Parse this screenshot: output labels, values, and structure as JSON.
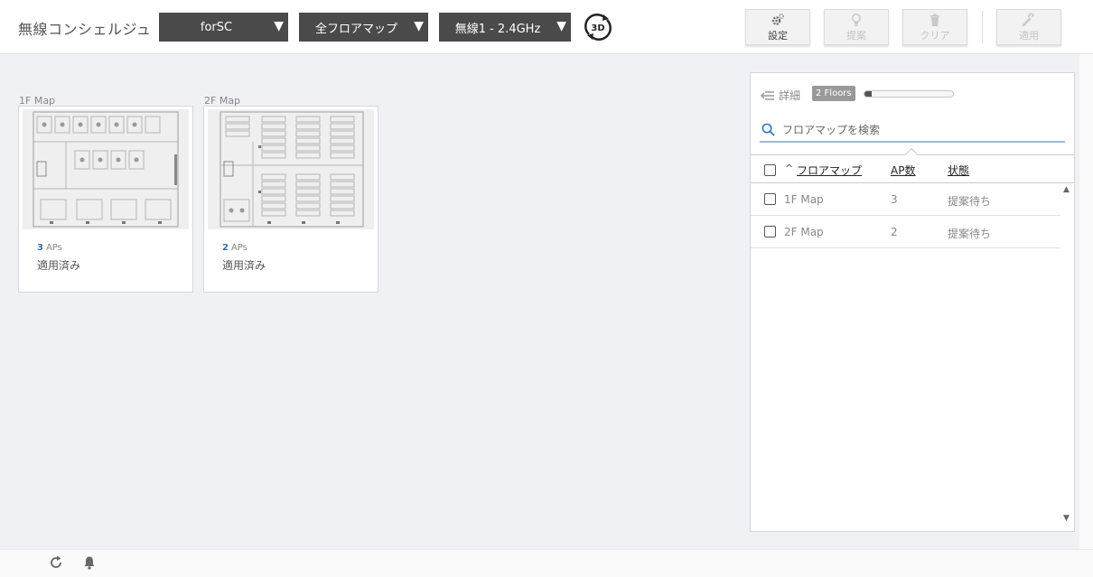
{
  "header": {
    "title": "無線コンシェルジュ",
    "dropdowns": [
      {
        "value": "forSC"
      },
      {
        "value": "全フロアマップ"
      },
      {
        "value": "無線1 - 2.4GHz"
      }
    ],
    "view_3d_icon": "3d-rotate-icon",
    "buttons": {
      "settings": {
        "label": "設定",
        "icon": "gear-icon",
        "enabled": true
      },
      "suggest": {
        "label": "提案",
        "icon": "lightbulb-icon",
        "enabled": false
      },
      "clear": {
        "label": "クリア",
        "icon": "trash-icon",
        "enabled": false
      },
      "apply": {
        "label": "適用",
        "icon": "wrench-icon",
        "enabled": false
      }
    }
  },
  "maps": [
    {
      "label": "1F Map",
      "aps": "3",
      "aps_unit": "APs",
      "status": "適用済み"
    },
    {
      "label": "2F Map",
      "aps": "2",
      "aps_unit": "APs",
      "status": "適用済み"
    }
  ],
  "panel": {
    "detail_label": "詳細",
    "floors_badge": "2 Floors",
    "progress_fraction": 0.08,
    "search_placeholder": "フロアマップを検索",
    "columns": {
      "sort_indicator": "^",
      "floor_map": "フロアマップ",
      "ap_count": "AP数",
      "status": "状態"
    },
    "rows": [
      {
        "name": "1F Map",
        "ap_count": "3",
        "status": "提案待ち"
      },
      {
        "name": "2F Map",
        "ap_count": "2",
        "status": "提案待ち"
      }
    ]
  },
  "footer": {
    "icons": [
      "refresh-icon",
      "bell-icon"
    ]
  },
  "colors": {
    "dropdown_bg": "#4a4a4a",
    "link_blue": "#3a6fa6",
    "search_underline": "#9fb8cf"
  }
}
